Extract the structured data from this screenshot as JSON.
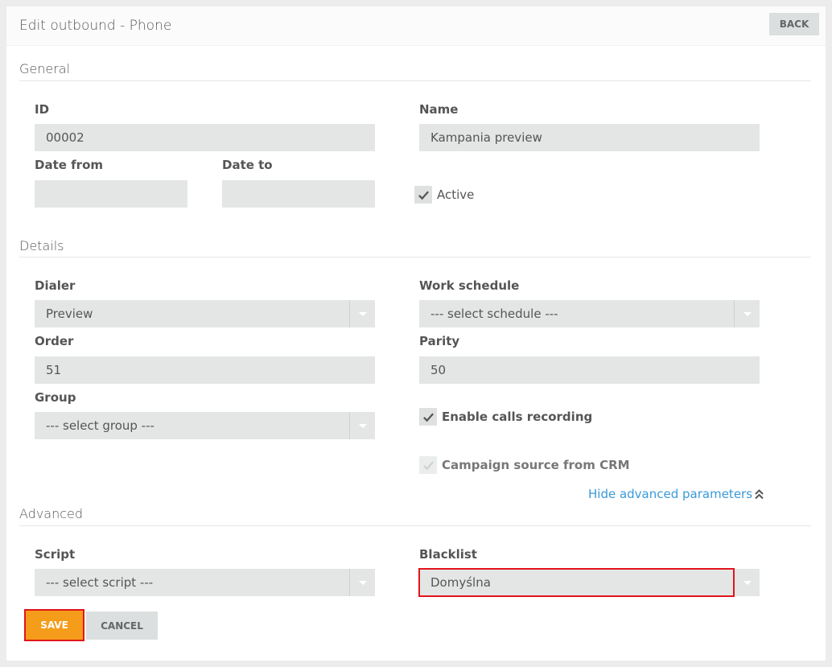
{
  "header": {
    "title": "Edit outbound - Phone",
    "back_label": "BACK"
  },
  "sections": {
    "general": "General",
    "details": "Details",
    "advanced": "Advanced"
  },
  "general": {
    "id_label": "ID",
    "id_value": "00002",
    "name_label": "Name",
    "name_value": "Kampania preview",
    "date_from_label": "Date from",
    "date_from_value": "",
    "date_to_label": "Date to",
    "date_to_value": "",
    "active_label": "Active",
    "active_checked": true
  },
  "details": {
    "dialer_label": "Dialer",
    "dialer_value": "Preview",
    "work_schedule_label": "Work schedule",
    "work_schedule_value": "--- select schedule ---",
    "order_label": "Order",
    "order_value": "51",
    "parity_label": "Parity",
    "parity_value": "50",
    "group_label": "Group",
    "group_value": "--- select group ---",
    "recording_label": "Enable calls recording",
    "recording_checked": true,
    "crm_label": "Campaign source from CRM",
    "crm_checked": true,
    "crm_disabled": true,
    "toggle_advanced_label": "Hide advanced parameters"
  },
  "advanced": {
    "script_label": "Script",
    "script_value": "--- select script ---",
    "blacklist_label": "Blacklist",
    "blacklist_value": "Domyślna"
  },
  "actions": {
    "save_label": "SAVE",
    "cancel_label": "CANCEL"
  },
  "colors": {
    "accent": "#f59c1a",
    "link": "#3a9ad9",
    "highlight": "#e2151b",
    "field_bg": "#e4e6e6"
  }
}
